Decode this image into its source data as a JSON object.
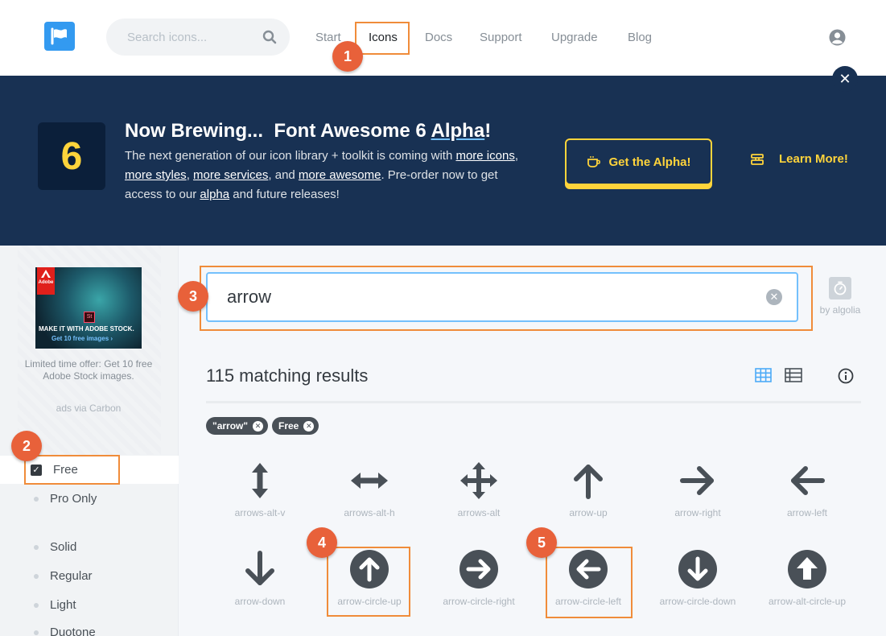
{
  "header": {
    "search_placeholder": "Search icons...",
    "nav": [
      "Start",
      "Icons",
      "Docs",
      "Support",
      "Upgrade",
      "Blog"
    ],
    "active_nav": "Icons"
  },
  "banner": {
    "badge_number": "6",
    "title_prefix": "Now Brewing...",
    "title_main": "Font Awesome 6",
    "title_alpha": "Alpha",
    "title_suffix": "!",
    "text": {
      "p1": "The next generation of our icon library + toolkit is coming with ",
      "l1": "more icons",
      "p2": ", ",
      "l2": "more styles",
      "p3": ", ",
      "l3": "more services",
      "p4": ", and ",
      "l4": "more awesome",
      "p5": ". Pre-order now to get access to our ",
      "l5": "alpha",
      "p6": " and future releases!"
    },
    "alpha_button": "Get the Alpha!",
    "learn_button": "Learn More!"
  },
  "ad": {
    "brand": "Adobe",
    "product": "St",
    "headline": "MAKE IT WITH ADOBE STOCK.",
    "cta": "Get 10 free images ›",
    "text": "Limited time offer: Get 10 free Adobe Stock images.",
    "via": "ads via Carbon"
  },
  "filters": [
    {
      "label": "Free",
      "checked": true
    },
    {
      "label": "Pro Only",
      "checked": false
    },
    {
      "label": "Solid",
      "checked": false
    },
    {
      "label": "Regular",
      "checked": false
    },
    {
      "label": "Light",
      "checked": false
    },
    {
      "label": "Duotone",
      "checked": false
    }
  ],
  "search": {
    "value": "arrow",
    "provider": "by algolia"
  },
  "results": {
    "count_text": "115 matching results",
    "tags": [
      "\"arrow\"",
      "Free"
    ]
  },
  "icons": [
    {
      "name": "arrows-alt-v"
    },
    {
      "name": "arrows-alt-h"
    },
    {
      "name": "arrows-alt"
    },
    {
      "name": "arrow-up"
    },
    {
      "name": "arrow-right"
    },
    {
      "name": "arrow-left"
    },
    {
      "name": "arrow-down"
    },
    {
      "name": "arrow-circle-up"
    },
    {
      "name": "arrow-circle-right"
    },
    {
      "name": "arrow-circle-left"
    },
    {
      "name": "arrow-circle-down"
    },
    {
      "name": "arrow-alt-circle-up"
    }
  ],
  "annotations": [
    "1",
    "2",
    "3",
    "4",
    "5"
  ],
  "colors": {
    "banner_bg": "#183153",
    "accent_yellow": "#ffd43b",
    "highlight_orange": "#f08c3a",
    "badge_red": "#e8613a",
    "focus_blue": "#74c0fc"
  }
}
